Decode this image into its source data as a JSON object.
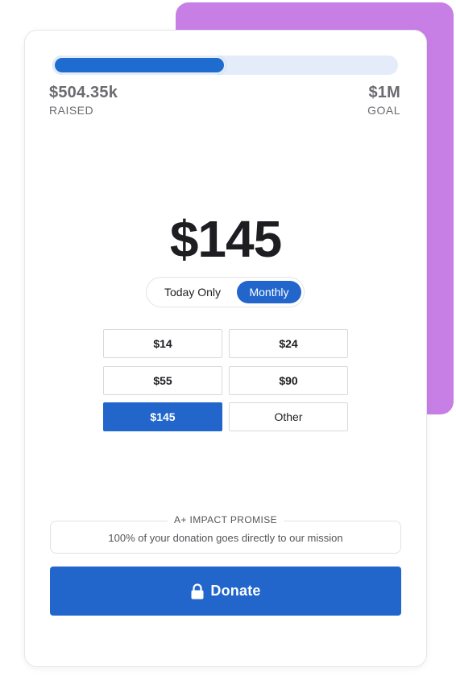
{
  "campaign": {
    "progress_percent": 50.4,
    "raised_amount": "$504.35k",
    "raised_label": "RAISED",
    "goal_amount": "$1M",
    "goal_label": "GOAL"
  },
  "donation": {
    "selected_amount_display": "$145",
    "frequency_options": [
      {
        "label": "Today Only",
        "selected": false
      },
      {
        "label": "Monthly",
        "selected": true
      }
    ],
    "amount_options": [
      {
        "label": "$14",
        "selected": false
      },
      {
        "label": "$24",
        "selected": false
      },
      {
        "label": "$55",
        "selected": false
      },
      {
        "label": "$90",
        "selected": false
      },
      {
        "label": "$145",
        "selected": true
      },
      {
        "label": "Other",
        "selected": false
      }
    ]
  },
  "promise": {
    "title": "A+ IMPACT PROMISE",
    "text": "100% of your donation goes directly to our mission"
  },
  "donate_button": {
    "label": "Donate",
    "icon": "lock-icon"
  },
  "colors": {
    "accent_panel": "#c77fe6",
    "primary": "#2266cc",
    "progress_track": "#e3ecf8"
  }
}
